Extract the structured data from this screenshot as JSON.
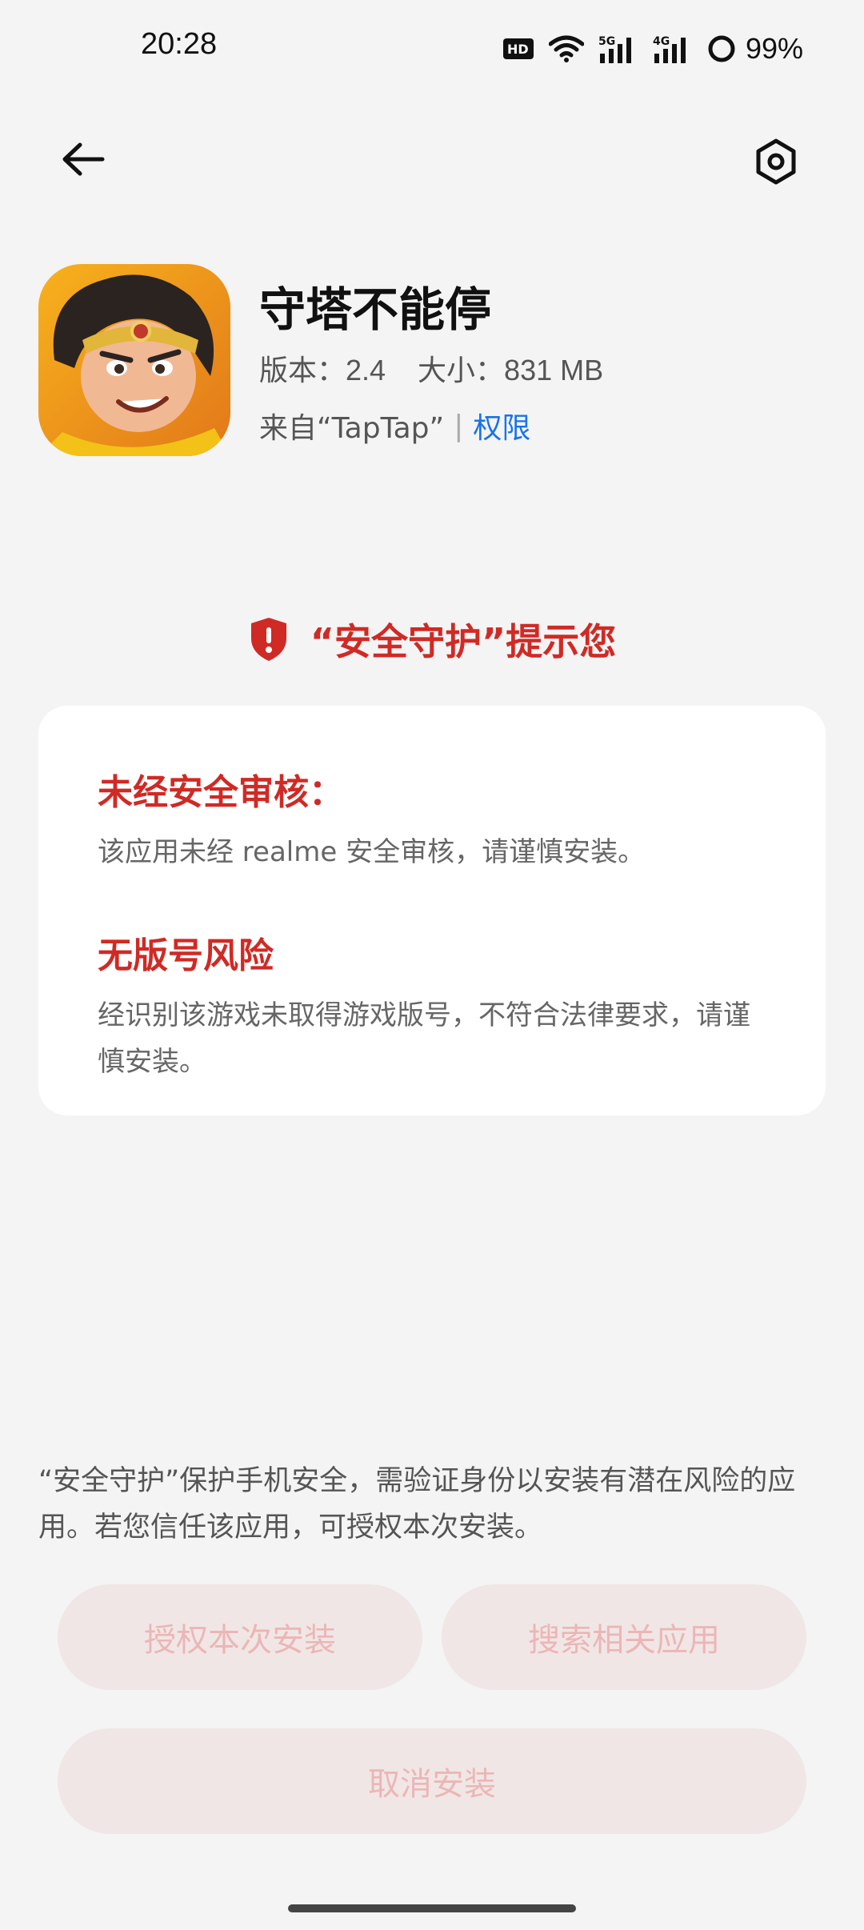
{
  "status_bar": {
    "time": "20:28",
    "battery": "99%",
    "icons": [
      "hd-icon",
      "wifi-icon",
      "signal-5g-icon",
      "signal-4g-icon",
      "battery-ring-icon"
    ]
  },
  "nav": {
    "back_icon": "arrow-left-icon",
    "settings_icon": "hexagon-gear-icon"
  },
  "app": {
    "name": "守塔不能停",
    "version": "版本：2.4",
    "size": "大小：831 MB",
    "source": "来自“TapTap”",
    "separator": "|",
    "permission_link": "权限"
  },
  "security": {
    "header": "“安全守护”提示您",
    "accent_color": "#d02a25",
    "warnings": [
      {
        "title": "未经安全审核：",
        "desc": "该应用未经 realme 安全审核，请谨慎安装。"
      },
      {
        "title": "无版号风险",
        "desc": "经识别该游戏未取得游戏版号，不符合法律要求，请谨慎安装。"
      }
    ]
  },
  "footer": {
    "notice": "“安全守护”保护手机安全，需验证身份以安装有潜在风险的应用。若您信任该应用，可授权本次安装。",
    "buttons": {
      "authorize": "授权本次安装",
      "search": "搜索相关应用",
      "cancel": "取消安装"
    }
  }
}
